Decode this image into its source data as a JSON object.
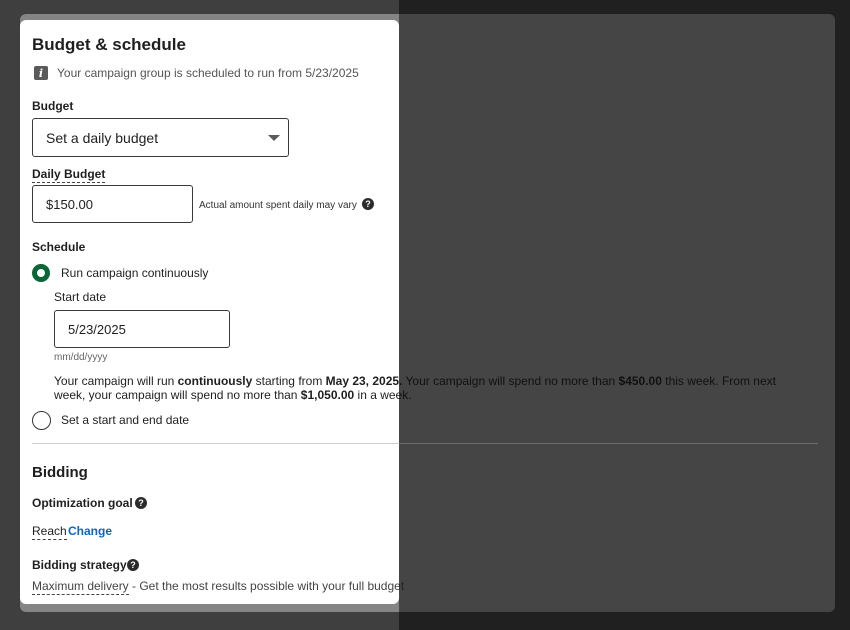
{
  "section": {
    "title": "Budget & schedule",
    "info_text": "Your campaign group is scheduled to run from 5/23/2025"
  },
  "budget": {
    "label": "Budget",
    "type_selected": "Set a daily budget",
    "daily_label": "Daily Budget",
    "daily_value": "$150.00",
    "daily_note": "Actual amount spent daily may vary"
  },
  "schedule": {
    "label": "Schedule",
    "option_continuous": "Run campaign continuously",
    "start_date_label": "Start date",
    "start_date_value": "5/23/2025",
    "date_format_hint": "mm/dd/yyyy",
    "summary": {
      "p1": "Your campaign will run ",
      "b1": "continuously",
      "p2": " starting from ",
      "b2": "May 23, 2025.",
      "p3": " Your campaign will spend no more than ",
      "b3": "$450.00",
      "p4": " this week. From next week, your campaign will spend no more than ",
      "b4": "$1,050.00",
      "p5": " in a week."
    },
    "option_start_end": "Set a start and end date",
    "selected_option": "continuous"
  },
  "bidding": {
    "title": "Bidding",
    "goal_label": "Optimization goal",
    "goal_value": "Reach",
    "change_link": "Change",
    "strategy_label": "Bidding strategy",
    "strategy_value": "Maximum delivery",
    "strategy_desc": " - Get the most results possible with your full budget"
  },
  "colors": {
    "overlay": "#7a7a7a",
    "radio_selected": "#0a6634",
    "link": "#0a66c2"
  },
  "icons": {
    "info": "info-icon",
    "dropdown": "caret-down-icon",
    "help": "question-circle-icon"
  }
}
